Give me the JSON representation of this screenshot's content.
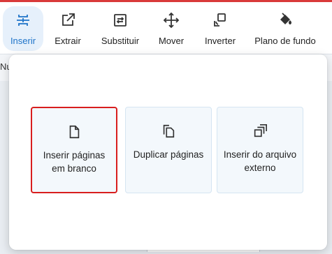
{
  "toolbar": {
    "items": [
      {
        "label": "Inserir",
        "icon": "insert-icon",
        "active": true
      },
      {
        "label": "Extrair",
        "icon": "extract-icon"
      },
      {
        "label": "Substituir",
        "icon": "replace-icon"
      },
      {
        "label": "Mover",
        "icon": "move-icon"
      },
      {
        "label": "Inverter",
        "icon": "rotate-icon"
      },
      {
        "label": "Plano de fundo",
        "icon": "paint-bucket-icon"
      }
    ]
  },
  "background_fragment": "Nu",
  "insert_menu": {
    "options": [
      {
        "label": "Inserir páginas em branco",
        "icon": "blank-page-icon",
        "selected": true
      },
      {
        "label": "Duplicar páginas",
        "icon": "duplicate-pages-icon"
      },
      {
        "label": "Inserir do arquivo externo",
        "icon": "external-file-icon"
      }
    ]
  },
  "colors": {
    "accent": "#1e73c8",
    "selection_border": "#d81e1e",
    "top_bar": "#d93a3a",
    "card_bg": "#f3f8fc"
  }
}
